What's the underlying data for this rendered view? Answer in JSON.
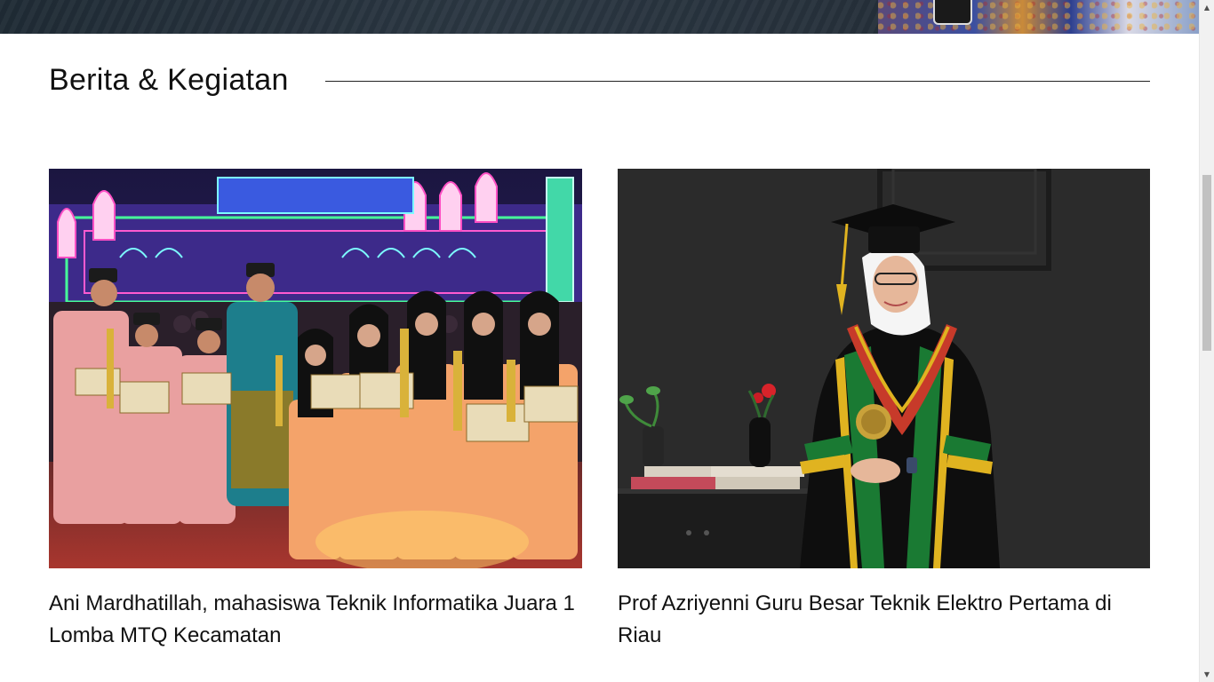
{
  "section": {
    "title": "Berita & Kegiatan"
  },
  "articles": [
    {
      "title": "Ani Mardhatillah, mahasiswa Teknik Informatika Juara 1 Lomba MTQ Kecamatan",
      "image_alt": "Group photo of MTQ participants holding certificates and trophies in front of a lit mosque stage"
    },
    {
      "title": "Prof Azriyenni Guru Besar Teknik Elektro Pertama di Riau",
      "image_alt": "Portrait of a professor in academic gown and cap"
    }
  ],
  "colors": {
    "text": "#111111",
    "rule": "#222222",
    "background": "#ffffff",
    "hero": "#26313b"
  }
}
